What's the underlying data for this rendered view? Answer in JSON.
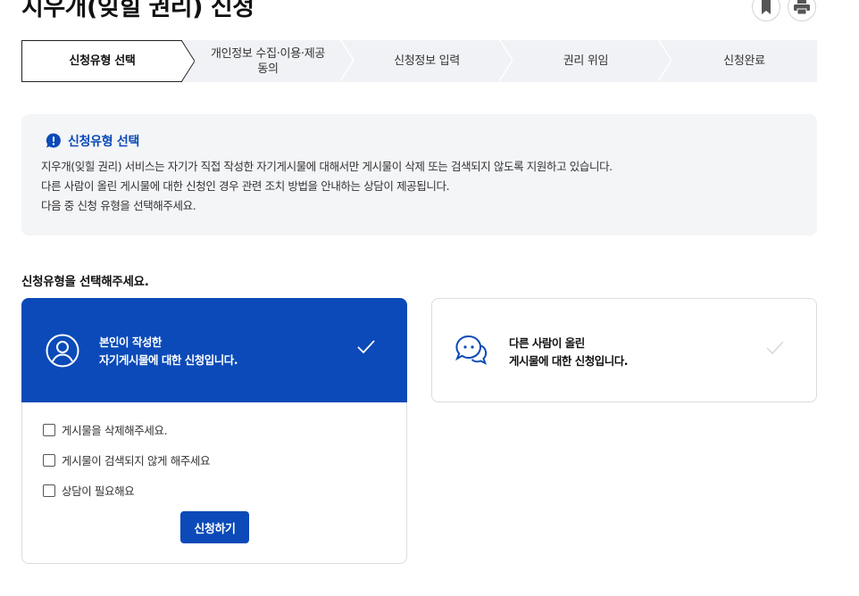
{
  "header": {
    "title": "지우개(잊힐 권리) 신청",
    "bookmark_icon": "bookmark-icon",
    "print_icon": "printer-icon"
  },
  "stepper": {
    "steps": [
      {
        "label": "신청유형 선택",
        "active": true
      },
      {
        "label_line1": "개인정보 수집·이용·제공",
        "label_line2": "동의",
        "active": false
      },
      {
        "label": "신청정보 입력",
        "active": false
      },
      {
        "label": "권리 위임",
        "active": false
      },
      {
        "label": "신청완료",
        "active": false
      }
    ]
  },
  "info": {
    "title": "신청유형 선택",
    "icon": "info-bubble-icon",
    "lines": [
      "지우개(잊힐 권리) 서비스는 자기가 직접 작성한 자기게시물에 대해서만 게시물이 삭제 또는 검색되지 않도록 지원하고 있습니다.",
      "다른 사람이 올린 게시물에 대한 신청인 경우 관련 조치 방법을 안내하는 상담이 제공됩니다.",
      "다음 중 신청 유형을 선택해주세요."
    ]
  },
  "selection": {
    "label": "신청유형을 선택해주세요.",
    "cards": [
      {
        "line1": "본인이 작성한",
        "line2": "자기게시물에 대한 신청입니다.",
        "icon": "user-icon",
        "selected": true
      },
      {
        "line1": "다른 사람이 올린",
        "line2": "게시물에 대한 신청입니다.",
        "icon": "chat-bubbles-icon",
        "selected": false
      }
    ],
    "options": [
      {
        "label": "게시물을 삭제해주세요.",
        "checked": false
      },
      {
        "label": "게시물이 검색되지 않게 해주세요",
        "checked": false
      },
      {
        "label": "상담이 필요해요",
        "checked": false
      }
    ],
    "submit_label": "신청하기"
  },
  "colors": {
    "primary": "#0b4ab8",
    "stepper_bg": "#f1f2f5",
    "info_bg": "#f4f5f7"
  }
}
